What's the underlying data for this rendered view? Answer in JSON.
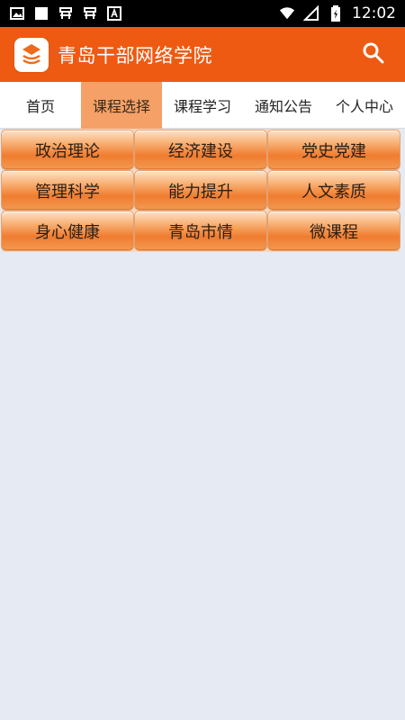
{
  "status_bar": {
    "time": "12:02",
    "left_icons": [
      "image-icon",
      "square-icon",
      "bug-icon",
      "bug-icon",
      "a-box-icon"
    ],
    "right_icons": [
      "wifi-icon",
      "signal-icon",
      "battery-icon"
    ]
  },
  "app_bar": {
    "title": "青岛干部网络学院",
    "logo_icon": "school-logo-icon",
    "search_icon": "search-icon",
    "color": "#ee5a12"
  },
  "tabs": [
    {
      "label": "首页",
      "active": false
    },
    {
      "label": "课程选择",
      "active": true
    },
    {
      "label": "课程学习",
      "active": false
    },
    {
      "label": "通知公告",
      "active": false
    },
    {
      "label": "个人中心",
      "active": false
    }
  ],
  "categories": [
    {
      "label": "政治理论"
    },
    {
      "label": "经济建设"
    },
    {
      "label": "党史党建"
    },
    {
      "label": "管理科学"
    },
    {
      "label": "能力提升"
    },
    {
      "label": "人文素质"
    },
    {
      "label": "身心健康"
    },
    {
      "label": "青岛市情"
    },
    {
      "label": "微课程"
    }
  ],
  "colors": {
    "accent": "#ee5a12",
    "active_tab": "#f4a066",
    "background": "#e6ebf3"
  }
}
